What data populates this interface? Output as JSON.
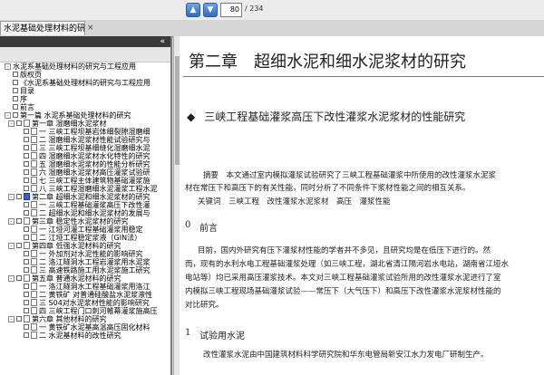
{
  "toolbar": {
    "page": "80",
    "total": "/ 234"
  },
  "tab": {
    "title": "水泥基础处理材料的研...",
    "close": "×"
  },
  "sidebar": {
    "collapse": "«",
    "items": [
      {
        "level": 0,
        "exp": "-",
        "chk": false,
        "text": "水泥系基础处理材料的研究与工程应用"
      },
      {
        "level": 1,
        "chk": true,
        "text": "版权页"
      },
      {
        "level": 1,
        "chk": true,
        "text": "《水泥系基础处理材料的研究与工程应用"
      },
      {
        "level": 1,
        "chk": true,
        "text": "目录"
      },
      {
        "level": 1,
        "chk": true,
        "text": "序"
      },
      {
        "level": 1,
        "chk": true,
        "text": "前言"
      },
      {
        "level": 1,
        "exp": "-",
        "chk": true,
        "text": "第一篇 水泥系基础处理材料的研究"
      },
      {
        "level": 2,
        "exp": "-",
        "chk": true,
        "text": "第一章 湿磨细水泥浆材"
      },
      {
        "level": 3,
        "chk": true,
        "text": "一 三峡工程坝基岩体细裂隙湿磨细"
      },
      {
        "level": 3,
        "chk": true,
        "text": "二 湿磨细水泥浆材性能试验研究与"
      },
      {
        "level": 3,
        "chk": true,
        "text": "三 三峡工程坝基细缝化湿磨细水泥"
      },
      {
        "level": 3,
        "chk": true,
        "text": "四 湿磨细水泥浆材水化特性的研究"
      },
      {
        "level": 3,
        "chk": true,
        "text": "五 湿磨细水泥浆材的性能分析研究"
      },
      {
        "level": 3,
        "chk": true,
        "text": "六 湿磨细水泥浆材高压灌浆试验研"
      },
      {
        "level": 3,
        "chk": true,
        "text": "七 三峡工程主体建筑物基础灌浆施"
      },
      {
        "level": 3,
        "chk": true,
        "text": "八 三峡工程湿磨细水泥灌浆工程水泥"
      },
      {
        "level": 2,
        "exp": "-",
        "chk": true,
        "blue": true,
        "text": "第二章 超细水泥和细水泥浆材的研究"
      },
      {
        "level": 3,
        "chk": true,
        "text": "一 三峡工程基础灌浆高压下改性灌"
      },
      {
        "level": 3,
        "chk": true,
        "text": "二 超细水泥和细水泥浆材的发展与"
      },
      {
        "level": 2,
        "exp": "-",
        "chk": true,
        "text": "第三章 稳定性水泥浆材的研究"
      },
      {
        "level": 3,
        "chk": true,
        "text": "一 江垭河灌工程基础灌浆用稳定"
      },
      {
        "level": 3,
        "chk": true,
        "text": "二 江垭工程稳定浆液（GIN法）"
      },
      {
        "level": 2,
        "exp": "-",
        "chk": true,
        "text": "第四章 低强水泥材料的研究"
      },
      {
        "level": 3,
        "chk": true,
        "text": "一 外加剂对水泥性能的影响研究"
      },
      {
        "level": 3,
        "chk": true,
        "text": "二 洛江隧洞水工程岩灌浆用水泥浆"
      },
      {
        "level": 3,
        "chk": true,
        "text": "三 高速铁路施工用水泥浆施工研究"
      },
      {
        "level": 2,
        "exp": "-",
        "chk": true,
        "text": "第五章 普通水泥材料的研究"
      },
      {
        "level": 3,
        "chk": true,
        "text": "一 洛江隧洞水工程基础灌浆用洛江"
      },
      {
        "level": 3,
        "chk": true,
        "text": "二 黄铁矿 对普通硅酸盐水泥浆液性"
      },
      {
        "level": 3,
        "chk": true,
        "text": "三 S04对水泥浆材性能的影响研究"
      },
      {
        "level": 3,
        "chk": true,
        "text": "四 三峡工程门口刺河帷幕灌浆施高压"
      },
      {
        "level": 2,
        "exp": "-",
        "chk": true,
        "text": "第六章 其他材料的研究"
      },
      {
        "level": 3,
        "chk": true,
        "text": "一 黄铁矿水泥基高温高压固化材料"
      },
      {
        "level": 3,
        "chk": true,
        "text": "二 水泥基材料的改性研究"
      }
    ]
  },
  "doc": {
    "chapter_title": "第二章　超细水泥和细水泥浆材的研究",
    "section_marker": "◆",
    "section_title": "三峡工程基础灌浆高压下改性灌浆水泥浆材的性能研究",
    "abstract": [
      "摘要　本文通过室内模拟灌浆试验研究了三峡工程基础灌浆中所使用的改性灌浆水泥浆",
      "材在常压下和高压下的有关性能，同时分析了不同条件下浆材性能之间的相互关系。",
      "关键词　三峡工程　改性灌浆水泥浆材　高压　灌浆性能"
    ],
    "h0_num": "0",
    "h0_title": "前言",
    "intro": [
      "目前，国内外研究有压下灌浆材性能的学者并不多见，且研究均是在低压下进行的。然",
      "而，现有的水利水电工程基础灌浆处理（如三峡工程，湖北省清江隔河岩水电站，湖南省江垭水",
      "电站等）均已采用高压灌浆技术。本文对三峡工程基础灌浆试验所用的改性灌浆水泥进行了室",
      "内模拟三峡工程现场基础灌浆试验——常压下（大气压下）和高压下改性灌浆水泥浆材性能的",
      "对比研究。"
    ],
    "h1_num": "1",
    "h1_title": "试验用水泥",
    "last": [
      "改性灌浆水泥由中国建筑材料科学研究院和华东电管局新安江水力发电厂研制生产。"
    ]
  }
}
